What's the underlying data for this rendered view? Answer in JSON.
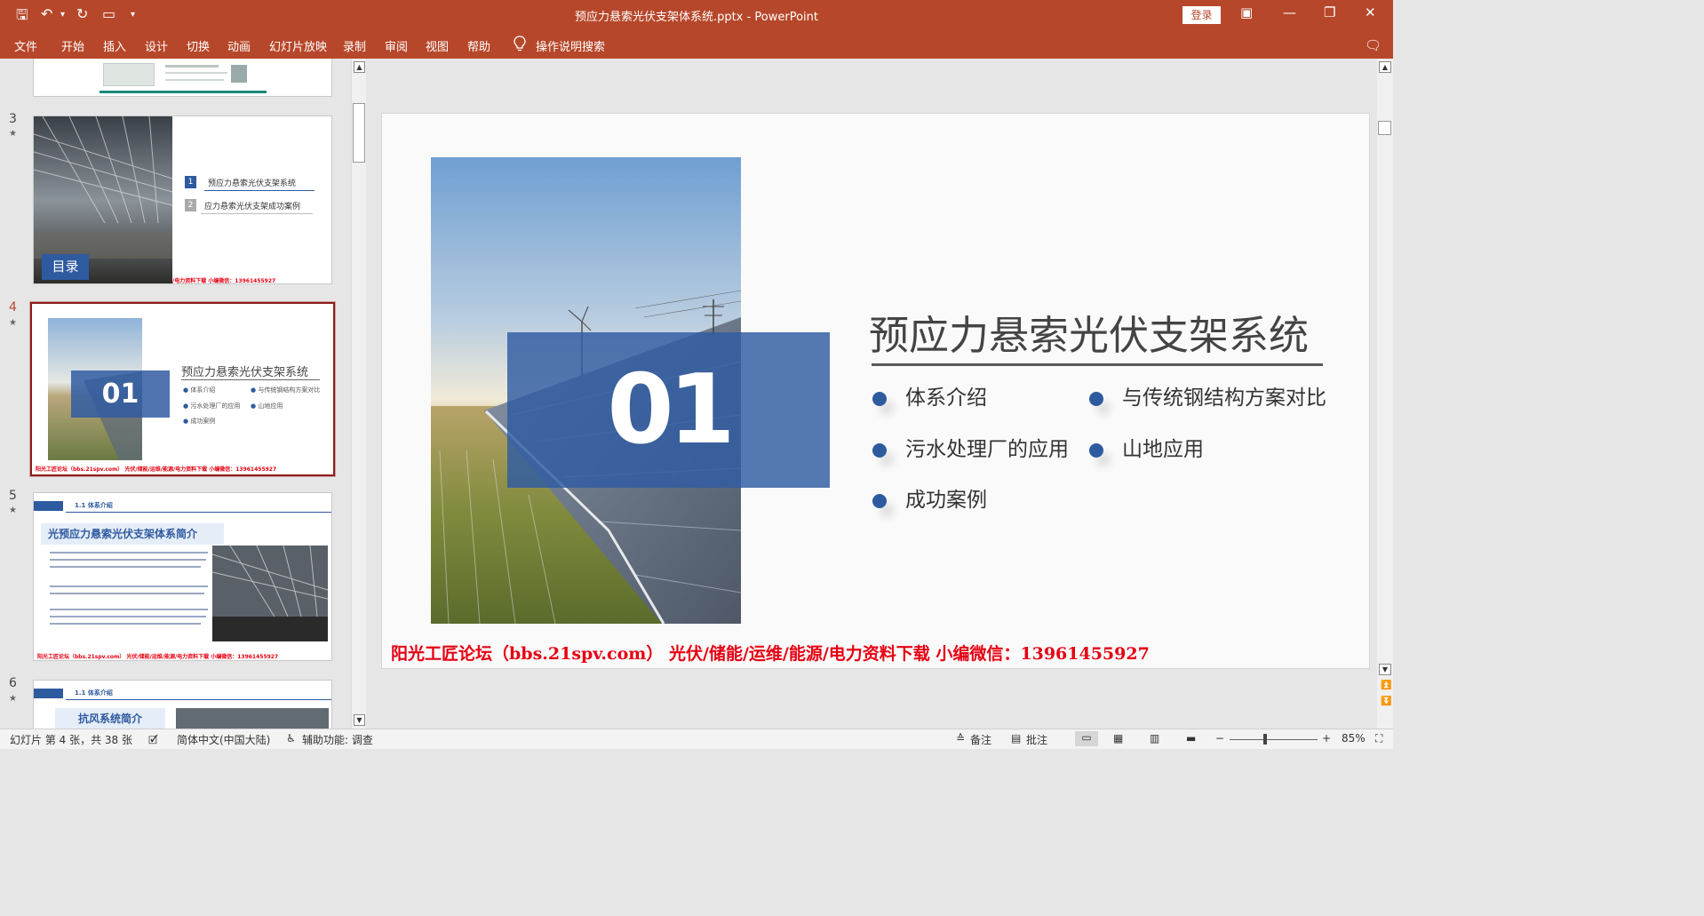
{
  "titlebar": {
    "document_title": "预应力悬索光伏支架体系统.pptx  -  PowerPoint",
    "login_label": "登录"
  },
  "ribbon": {
    "tabs": [
      "文件",
      "开始",
      "插入",
      "设计",
      "切换",
      "动画",
      "幻灯片放映",
      "录制",
      "审阅",
      "视图",
      "帮助"
    ],
    "search_label": "操作说明搜索"
  },
  "thumbnails": [
    {
      "number": "",
      "star": false
    },
    {
      "number": "3",
      "star": true,
      "toc_title": "目录",
      "toc_items": [
        {
          "num": "1",
          "text": "预应力悬索光伏支架系统"
        },
        {
          "num": "2",
          "text": "应力悬索光伏支架成功案例"
        }
      ],
      "footer": "/电力资料下载  小编微信：13961455927"
    },
    {
      "number": "4",
      "star": true,
      "active": true,
      "num_label": "01",
      "title": "预应力悬索光伏支架系统",
      "items": [
        "体系介绍",
        "与传统钢结构方案对比",
        "污水处理厂的应用",
        "山地应用",
        "成功案例"
      ],
      "footer": "阳光工匠论坛（bbs.21spv.com）  光伏/储能/运维/能源/电力资料下载  小编微信：13961455927"
    },
    {
      "number": "5",
      "star": true,
      "section": "1.1  体系介绍",
      "heading": "光预应力悬索光伏支架体系简介",
      "footer": "阳光工匠论坛（bbs.21spv.com）  光伏/储能/运维/能源/电力资料下载  小编微信：13961455927"
    },
    {
      "number": "6",
      "star": true,
      "section": "1.1  体系介绍",
      "heading": "抗风系统简介"
    }
  ],
  "slide": {
    "number_label": "01",
    "title": "预应力悬索光伏支架系统",
    "bullets": [
      "体系介绍",
      "与传统钢结构方案对比",
      "污水处理厂的应用",
      "山地应用",
      "成功案例"
    ],
    "footer": "阳光工匠论坛（bbs.21spv.com）   光伏/储能/运维/能源/电力资料下载  小编微信：13961455927"
  },
  "statusbar": {
    "slide_info": "幻灯片 第 4 张，共 38 张",
    "language": "简体中文(中国大陆)",
    "accessibility": "辅助功能: 调查",
    "notes_label": "备注",
    "comments_label": "批注",
    "zoom": "85%"
  },
  "colors": {
    "accent": "#b7472a",
    "slide_blue": "#2e5aa0",
    "footer_red": "#e60012"
  }
}
